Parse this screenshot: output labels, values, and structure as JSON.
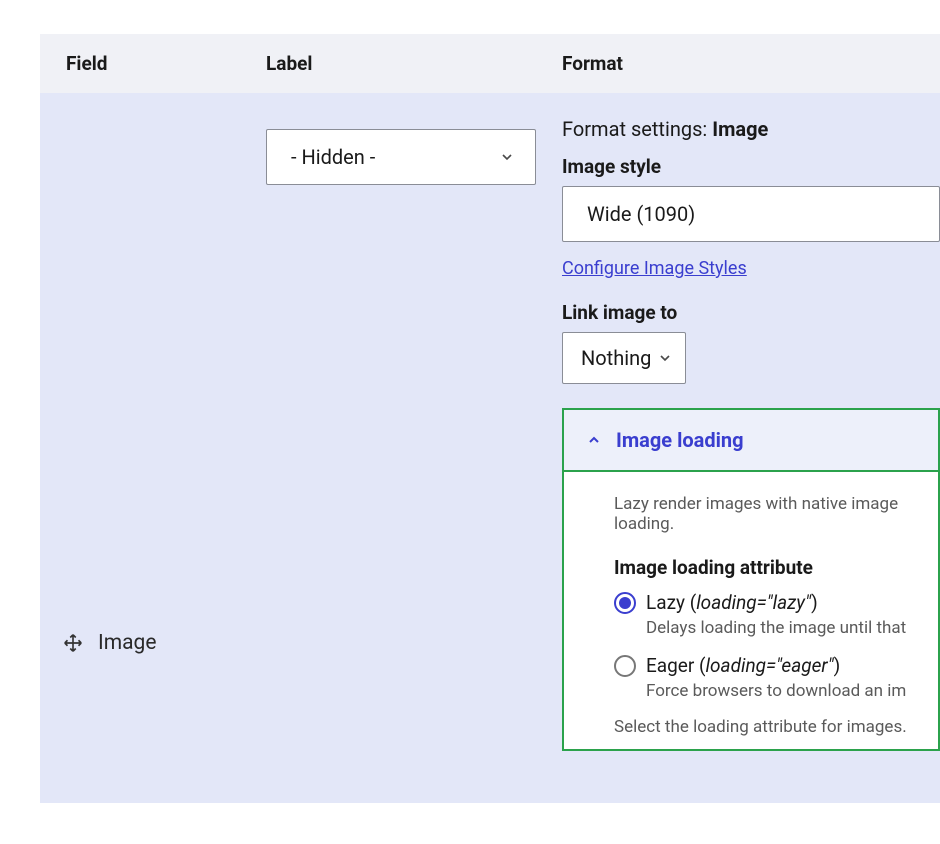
{
  "header": {
    "field": "Field",
    "label": "Label",
    "format": "Format"
  },
  "row": {
    "field_name": "Image",
    "label_select_value": "- Hidden -"
  },
  "format": {
    "settings_prefix": "Format settings: ",
    "settings_name": "Image",
    "image_style_label": "Image style",
    "image_style_value": "Wide (1090)",
    "configure_link": "Configure Image Styles",
    "link_image_to_label": "Link image to",
    "link_image_to_value": "Nothing"
  },
  "panel": {
    "title": "Image loading",
    "intro": "Lazy render images with native image loading.",
    "attr_label": "Image loading attribute",
    "lazy_label_prefix": "Lazy (",
    "lazy_label_code": "loading=\"lazy\"",
    "lazy_label_suffix": ")",
    "lazy_help": "Delays loading the image until that",
    "eager_label_prefix": "Eager (",
    "eager_label_code": "loading=\"eager\"",
    "eager_label_suffix": ")",
    "eager_help": "Force browsers to download an im",
    "footer_help": "Select the loading attribute for images."
  }
}
